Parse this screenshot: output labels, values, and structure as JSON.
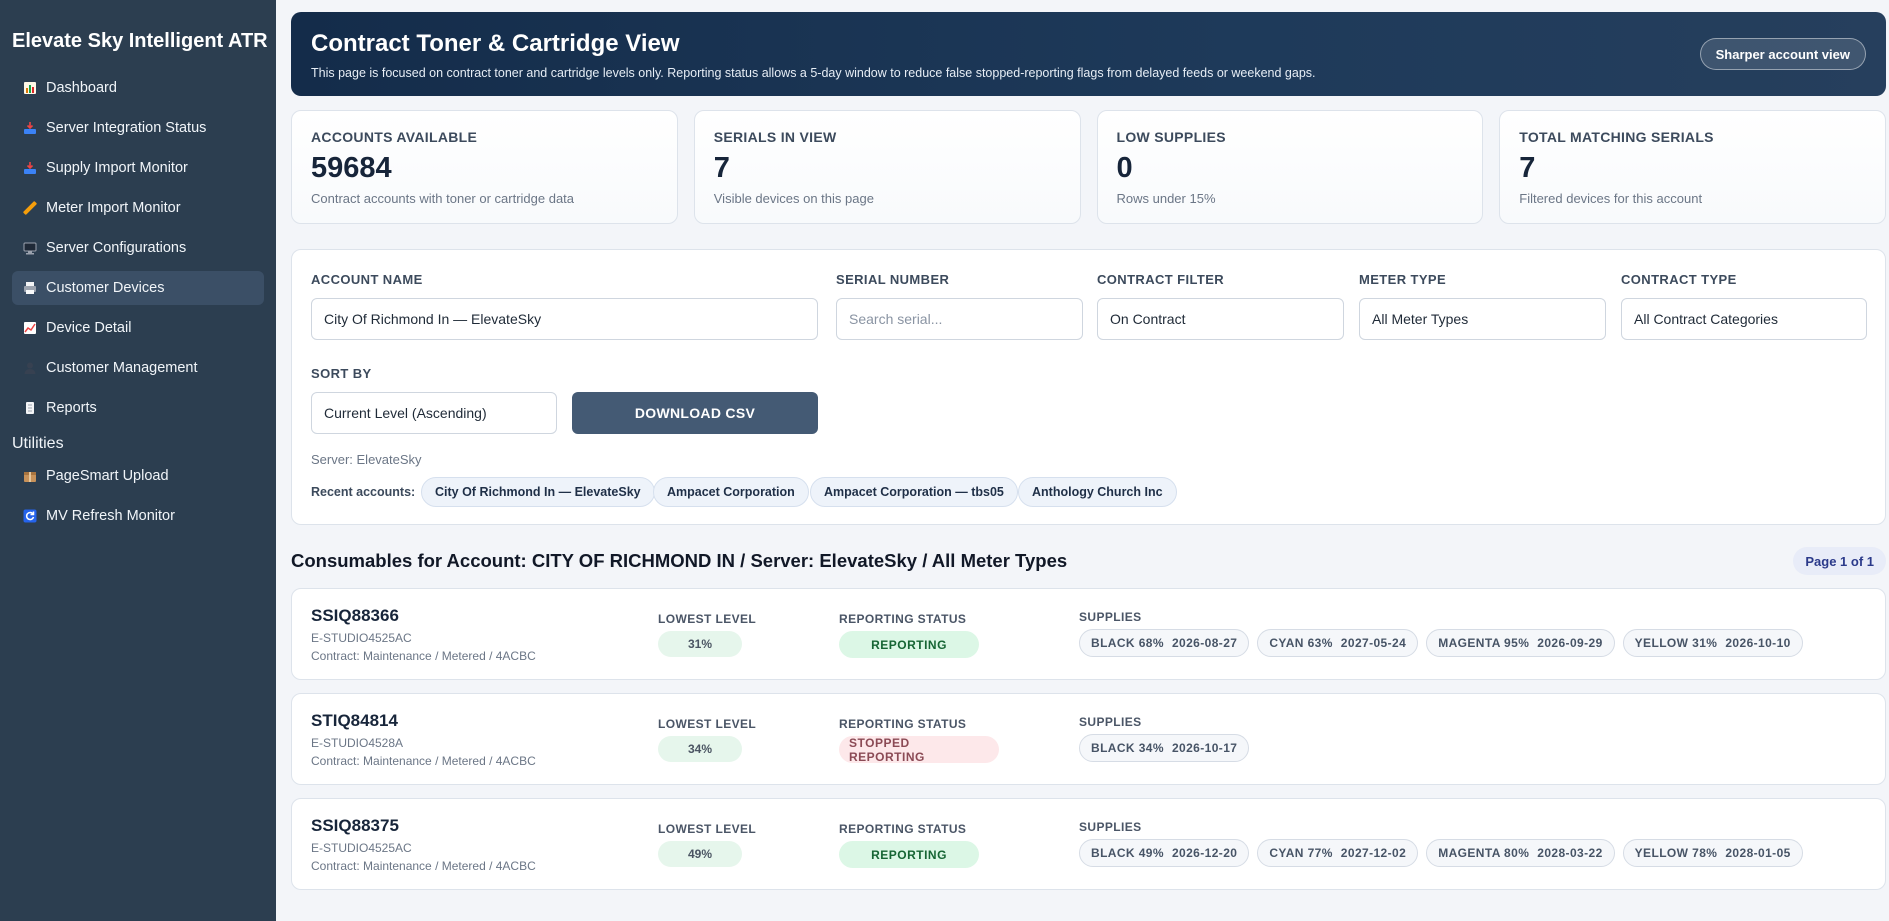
{
  "app": {
    "title": "Elevate Sky Intelligent ATR"
  },
  "sidebar": {
    "items": [
      {
        "label": "Dashboard",
        "icon": "bar-chart-icon",
        "color": "#f59e0b"
      },
      {
        "label": "Server Integration Status",
        "icon": "inbox-tray-icon",
        "color": "#60a5fa"
      },
      {
        "label": "Supply Import Monitor",
        "icon": "inbox-tray-icon",
        "color": "#60a5fa"
      },
      {
        "label": "Meter Import Monitor",
        "icon": "ruler-icon",
        "color": "#f59e0b"
      },
      {
        "label": "Server Configurations",
        "icon": "desktop-icon",
        "color": "#94a3b8"
      },
      {
        "label": "Customer Devices",
        "icon": "printer-icon",
        "color": "#e5e7eb"
      },
      {
        "label": "Device Detail",
        "icon": "line-chart-icon",
        "color": "#f87171"
      },
      {
        "label": "Customer Management",
        "icon": "users-icon",
        "color": "#94a3b8"
      },
      {
        "label": "Reports",
        "icon": "document-icon",
        "color": "#e5e7eb"
      }
    ],
    "utilities_label": "Utilities",
    "utilities": [
      {
        "label": "PageSmart Upload",
        "icon": "package-icon",
        "color": "#d6a26a"
      },
      {
        "label": "MV Refresh Monitor",
        "icon": "refresh-icon",
        "color": "#3b82f6"
      }
    ]
  },
  "hero": {
    "title": "Contract Toner & Cartridge View",
    "description": "This page is focused on contract toner and cartridge levels only. Reporting status allows a 5-day window to reduce false stopped-reporting flags from delayed feeds or weekend gaps.",
    "button_label": "Sharper account view"
  },
  "stats": [
    {
      "label": "ACCOUNTS AVAILABLE",
      "value": "59684",
      "sub": "Contract accounts with toner or cartridge data"
    },
    {
      "label": "SERIALS IN VIEW",
      "value": "7",
      "sub": "Visible devices on this page"
    },
    {
      "label": "LOW SUPPLIES",
      "value": "0",
      "sub": "Rows under 15%"
    },
    {
      "label": "TOTAL MATCHING SERIALS",
      "value": "7",
      "sub": "Filtered devices for this account"
    }
  ],
  "filters": {
    "account_name": {
      "label": "ACCOUNT NAME",
      "value": "City Of Richmond In — ElevateSky"
    },
    "serial_number": {
      "label": "SERIAL NUMBER",
      "placeholder": "Search serial..."
    },
    "contract_filter": {
      "label": "CONTRACT FILTER",
      "value": "On Contract"
    },
    "meter_type": {
      "label": "METER TYPE",
      "value": "All Meter Types"
    },
    "contract_type": {
      "label": "CONTRACT TYPE",
      "value": "All Contract Categories"
    },
    "sort_by": {
      "label": "SORT BY",
      "value": "Current Level (Ascending)"
    },
    "download_label": "DOWNLOAD CSV",
    "server_line": "Server: ElevateSky",
    "recent_label": "Recent accounts:",
    "recent_accounts": [
      "City Of Richmond In — ElevateSky",
      "Ampacet Corporation",
      "Ampacet Corporation — tbs05",
      "Anthology Church Inc"
    ]
  },
  "section": {
    "title": "Consumables for Account: CITY OF RICHMOND IN / Server: ElevateSky / All Meter Types",
    "page_badge": "Page 1 of 1"
  },
  "columns": {
    "lowest_level": "LOWEST LEVEL",
    "reporting_status": "REPORTING STATUS",
    "supplies": "SUPPLIES"
  },
  "devices": [
    {
      "serial": "SSIQ88366",
      "model": "E-STUDIO4525AC",
      "contract": "Contract: Maintenance / Metered / 4ACBC",
      "lowest_level": "31%",
      "status": "REPORTING",
      "supplies": [
        {
          "name": "BLACK 68%",
          "date": "2026-08-27"
        },
        {
          "name": "CYAN 63%",
          "date": "2027-05-24"
        },
        {
          "name": "MAGENTA 95%",
          "date": "2026-09-29"
        },
        {
          "name": "YELLOW 31%",
          "date": "2026-10-10"
        }
      ]
    },
    {
      "serial": "STIQ84814",
      "model": "E-STUDIO4528A",
      "contract": "Contract: Maintenance / Metered / 4ACBC",
      "lowest_level": "34%",
      "status": "STOPPED REPORTING",
      "supplies": [
        {
          "name": "BLACK 34%",
          "date": "2026-10-17"
        }
      ]
    },
    {
      "serial": "SSIQ88375",
      "model": "E-STUDIO4525AC",
      "contract": "Contract: Maintenance / Metered / 4ACBC",
      "lowest_level": "49%",
      "status": "REPORTING",
      "supplies": [
        {
          "name": "BLACK 49%",
          "date": "2026-12-20"
        },
        {
          "name": "CYAN 77%",
          "date": "2027-12-02"
        },
        {
          "name": "MAGENTA 80%",
          "date": "2028-03-22"
        },
        {
          "name": "YELLOW 78%",
          "date": "2028-01-05"
        }
      ]
    }
  ]
}
